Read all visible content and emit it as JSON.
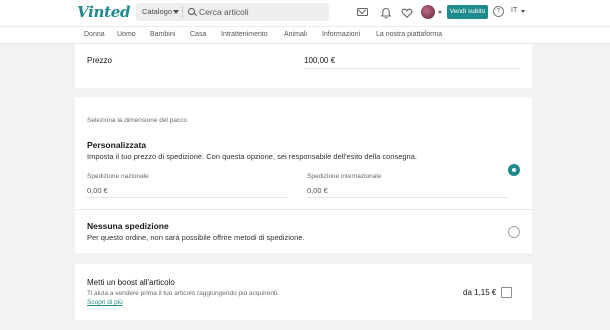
{
  "header": {
    "logo": "Vinted",
    "catalog_label": "Catalogo",
    "search_placeholder": "Cerca articoli",
    "sell_button": "Vendi subito",
    "help_glyph": "?",
    "language": "IT",
    "icons": [
      "mail-icon",
      "bell-icon",
      "heart-icon",
      "avatar",
      "help-icon"
    ]
  },
  "nav": {
    "items": [
      "Donna",
      "Uomo",
      "Bambini",
      "Casa",
      "Intrattenimento",
      "Animali",
      "Informazioni",
      "La nostra piattaforma"
    ]
  },
  "price": {
    "label": "Prezzo",
    "value": "100,00 €"
  },
  "shipping": {
    "section_title": "Seleziona la dimensione del pacco",
    "custom": {
      "title": "Personalizzata",
      "description": "Imposta il tuo prezzo di spedizione. Con questa opzione, sei responsabile dell'esito della consegna.",
      "selected": true,
      "national_label": "Spedizione nazionale",
      "national_value": "0,00 €",
      "international_label": "Spedizione internazionale",
      "international_value": "0,00 €"
    },
    "none": {
      "title": "Nessuna spedizione",
      "description": "Per questo ordine, non sarà possibile offrire metodi di spedizione.",
      "selected": false
    }
  },
  "boost": {
    "title": "Metti un boost all'articolo",
    "description": "Ti aiuta a vendere prima il tuo articolo raggiungendo più acquirenti.",
    "link": "Scopri di più",
    "price": "da 1,15 €",
    "checked": false
  },
  "colors": {
    "accent": "#1f8a8e",
    "background": "#f2f2f2"
  }
}
